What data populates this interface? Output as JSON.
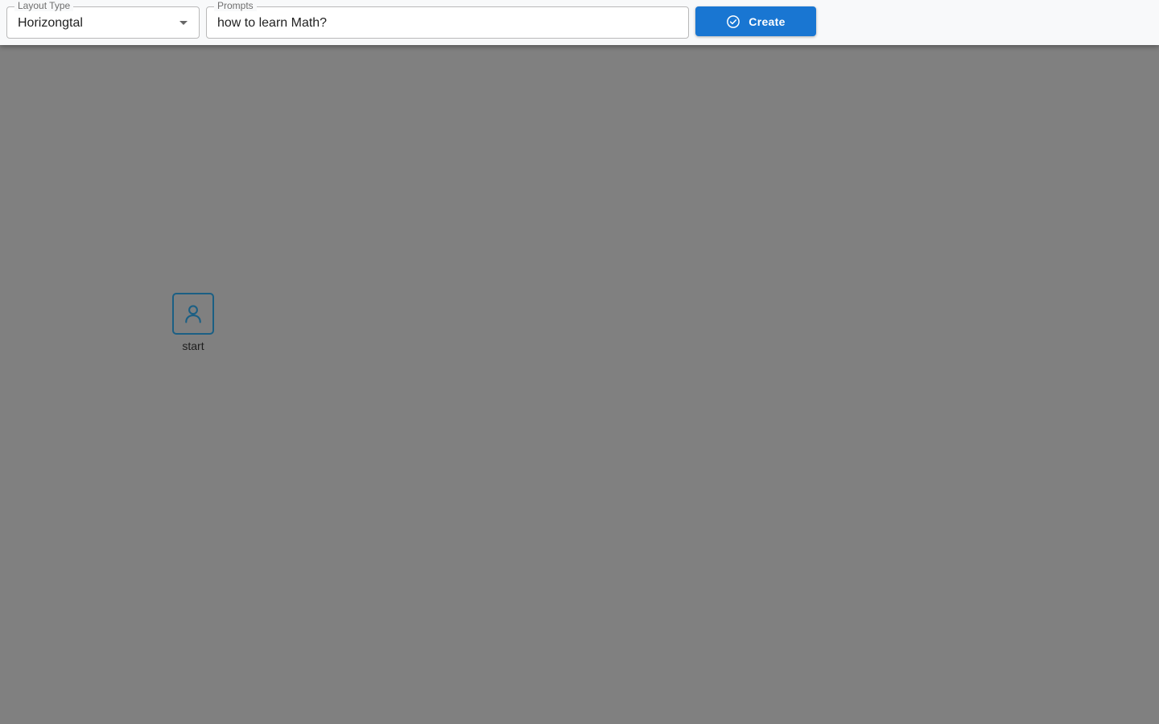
{
  "toolbar": {
    "layout_type": {
      "label": "Layout Type",
      "selected": "Horizongtal"
    },
    "prompts": {
      "label": "Prompts",
      "value": "how to learn Math?"
    },
    "create_button": {
      "label": "Create",
      "icon": "check-circle-icon"
    }
  },
  "canvas": {
    "nodes": [
      {
        "label": "start",
        "icon": "user-icon"
      }
    ]
  },
  "colors": {
    "accent": "#1976d2",
    "node_border": "#1b5f84",
    "canvas_background": "#808080",
    "toolbar_background": "#f8f9fa"
  }
}
